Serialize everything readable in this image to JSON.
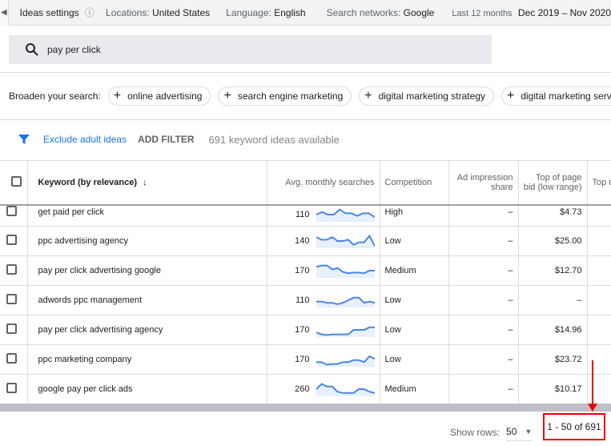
{
  "topbar": {
    "ideas_settings": "Ideas settings",
    "locations_label": "Locations:",
    "locations_value": "United States",
    "language_label": "Language:",
    "language_value": "English",
    "networks_label": "Search networks:",
    "networks_value": "Google",
    "period_label": "Last 12 months",
    "period_value": "Dec 2019 – Nov 2020"
  },
  "search": {
    "value": "pay per click"
  },
  "broaden": {
    "label": "Broaden your search:",
    "chips": [
      "online advertising",
      "search engine marketing",
      "digital marketing strategy",
      "digital marketing services"
    ]
  },
  "filters": {
    "exclude": "Exclude adult ideas",
    "add": "ADD FILTER",
    "count": "691 keyword ideas available"
  },
  "table": {
    "headers": [
      "Keyword (by relevance)",
      "Avg. monthly searches",
      "Competition",
      "Ad impression share",
      "Top of page bid (low range)",
      "Top of page bid (high range)"
    ],
    "rows": [
      {
        "keyword": "get paid per click",
        "avg": "110",
        "competition": "High",
        "share": "–",
        "bid_low": "$4.73",
        "trend": [
          5,
          7,
          5,
          5,
          9,
          6,
          6,
          4,
          6,
          6,
          3
        ]
      },
      {
        "keyword": "ppc advertising agency",
        "avg": "140",
        "competition": "Low",
        "share": "–",
        "bid_low": "$25.00",
        "trend": [
          8,
          6,
          6,
          8,
          5,
          5,
          6,
          2,
          4,
          4,
          9,
          1
        ]
      },
      {
        "keyword": "pay per click advertising google",
        "avg": "170",
        "competition": "Medium",
        "share": "–",
        "bid_low": "$12.70",
        "trend": [
          8,
          9,
          9,
          6,
          7,
          4,
          3,
          3.5,
          3.5,
          3,
          5,
          5
        ]
      },
      {
        "keyword": "adwords ppc management",
        "avg": "110",
        "competition": "Low",
        "share": "–",
        "bid_low": "–",
        "trend": [
          4,
          4,
          3,
          3,
          2,
          3,
          5,
          7,
          7,
          3,
          4,
          3
        ]
      },
      {
        "keyword": "pay per click advertising agency",
        "avg": "170",
        "competition": "Low",
        "share": "–",
        "bid_low": "$14.96",
        "trend": [
          3,
          1.5,
          1,
          1.5,
          1.5,
          1.5,
          1.5,
          5,
          5,
          5,
          7,
          7
        ]
      },
      {
        "keyword": "ppc marketing company",
        "avg": "170",
        "competition": "Low",
        "share": "–",
        "bid_low": "$23.72",
        "trend": [
          3,
          3,
          1,
          1.5,
          1.5,
          3,
          3,
          4.5,
          4.5,
          3,
          7.5,
          5.5
        ]
      },
      {
        "keyword": "google pay per click ads",
        "avg": "260",
        "competition": "Medium",
        "share": "–",
        "bid_low": "$10.17",
        "trend": [
          5,
          9,
          7,
          7,
          3,
          2,
          2,
          2,
          5,
          5,
          3,
          2
        ]
      }
    ]
  },
  "footer": {
    "show_rows_label": "Show rows:",
    "show_rows_value": "50",
    "pagination": "1 - 50 of 691"
  },
  "colors": {
    "accent": "#1a73e8",
    "sparkline": "#4a86e8",
    "highlight": "#e00000"
  }
}
